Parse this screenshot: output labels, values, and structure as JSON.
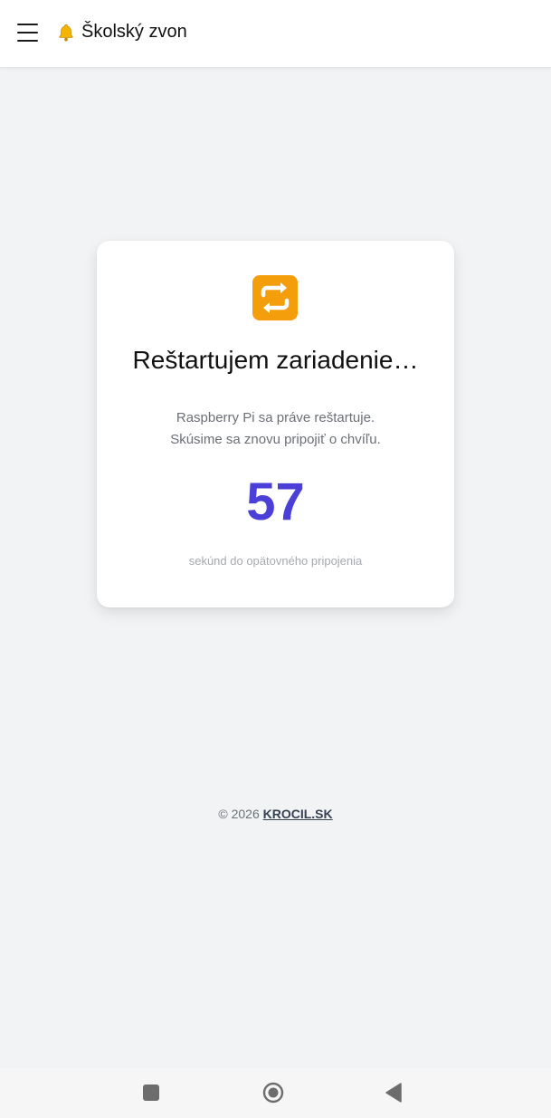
{
  "header": {
    "menu_icon": "hamburger-menu-icon",
    "app_icon": "bell-icon",
    "title": "Školský zvon"
  },
  "card": {
    "icon": "restart-arrows-icon",
    "title": "Reštartujem zariadenie…",
    "description_line1": "Raspberry Pi sa práve reštartuje.",
    "description_line2": "Skúsime sa znovu pripojiť o chvíľu.",
    "countdown": "57",
    "countdown_label": "sekúnd do opätovného pripojenia"
  },
  "footer": {
    "copyright": "© 2026",
    "link_text": "KROCIL.SK"
  },
  "system_nav": {
    "recents_icon": "square-recents-icon",
    "home_icon": "circle-home-icon",
    "back_icon": "triangle-back-icon"
  },
  "colors": {
    "accent": "#4a3fd6",
    "background": "#f2f3f5",
    "card": "#ffffff",
    "restart_icon": "#f59e0b"
  }
}
